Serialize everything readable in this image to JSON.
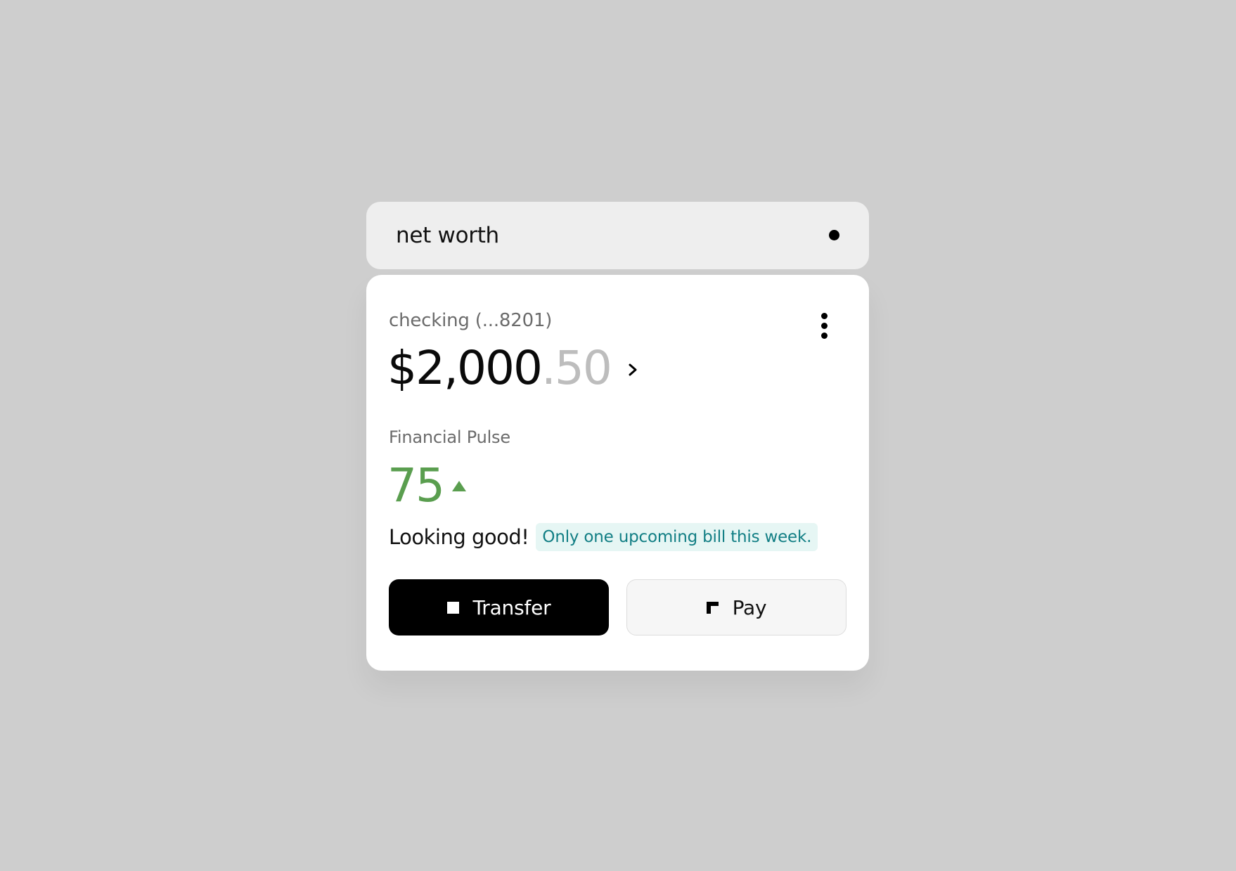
{
  "header": {
    "title": "net worth",
    "indicator_icon": "dot-icon"
  },
  "account": {
    "label": "checking (...8201)",
    "balance_whole": "$2,000",
    "balance_cents": ".50",
    "more_icon": "vertical-ellipsis-icon",
    "chevron_icon": "chevron-right-icon"
  },
  "pulse": {
    "label": "Financial Pulse",
    "score": "75",
    "trend_icon": "triangle-up-icon",
    "status": "Looking good!",
    "note": "Only one upcoming bill this week."
  },
  "actions": {
    "transfer_label": "Transfer",
    "transfer_icon": "square-icon",
    "pay_label": "Pay",
    "pay_icon": "corner-bracket-icon"
  },
  "colors": {
    "background": "#cecece",
    "score_green": "#5a9e4f",
    "note_teal": "#117e84",
    "note_bg": "#e6f6f4",
    "cents_gray": "#bdbdbd"
  }
}
